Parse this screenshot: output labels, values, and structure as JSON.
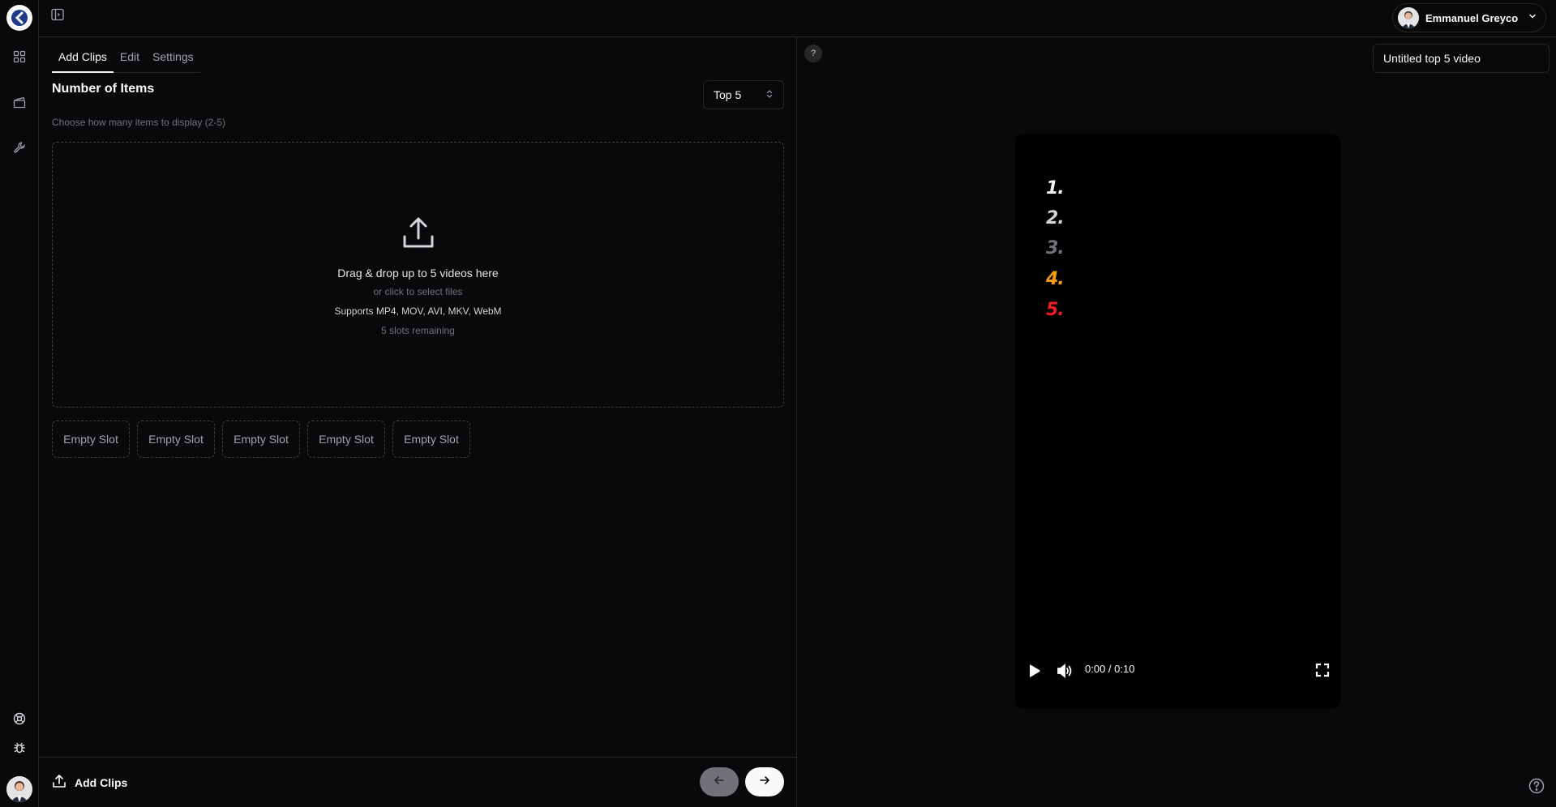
{
  "header": {
    "user_name": "Emmanuel Greyco"
  },
  "icons": {
    "logo": "app-logo-icon",
    "nav": [
      "grid-icon",
      "clapperboard-icon",
      "wrench-icon"
    ],
    "bottom": [
      "lifebuoy-icon",
      "bug-icon"
    ]
  },
  "tabs": [
    {
      "label": "Add Clips",
      "active": true
    },
    {
      "label": "Edit",
      "active": false
    },
    {
      "label": "Settings",
      "active": false
    }
  ],
  "items": {
    "title": "Number of Items",
    "help": "Choose how many items to display (2-5)",
    "selected": "Top 5"
  },
  "dropzone": {
    "main": "Drag & drop up to 5 videos here",
    "sub": "or click to select files",
    "formats": "Supports MP4, MOV, AVI, MKV, WebM",
    "remaining": "5 slots remaining"
  },
  "slots": [
    "Empty Slot",
    "Empty Slot",
    "Empty Slot",
    "Empty Slot",
    "Empty Slot"
  ],
  "footer": {
    "add_clips_label": "Add Clips"
  },
  "preview": {
    "help_label": "?",
    "video_title": "Untitled top 5 video",
    "time": "0:00 / 0:10",
    "progress": 0,
    "ranks": [
      {
        "label": "1.",
        "color": "#f4f4f5"
      },
      {
        "label": "2.",
        "color": "#d4d4d8"
      },
      {
        "label": "3.",
        "color": "#71717a"
      },
      {
        "label": "4.",
        "color": "#f59e0b"
      },
      {
        "label": "5.",
        "color": "#ef1c24"
      }
    ]
  }
}
